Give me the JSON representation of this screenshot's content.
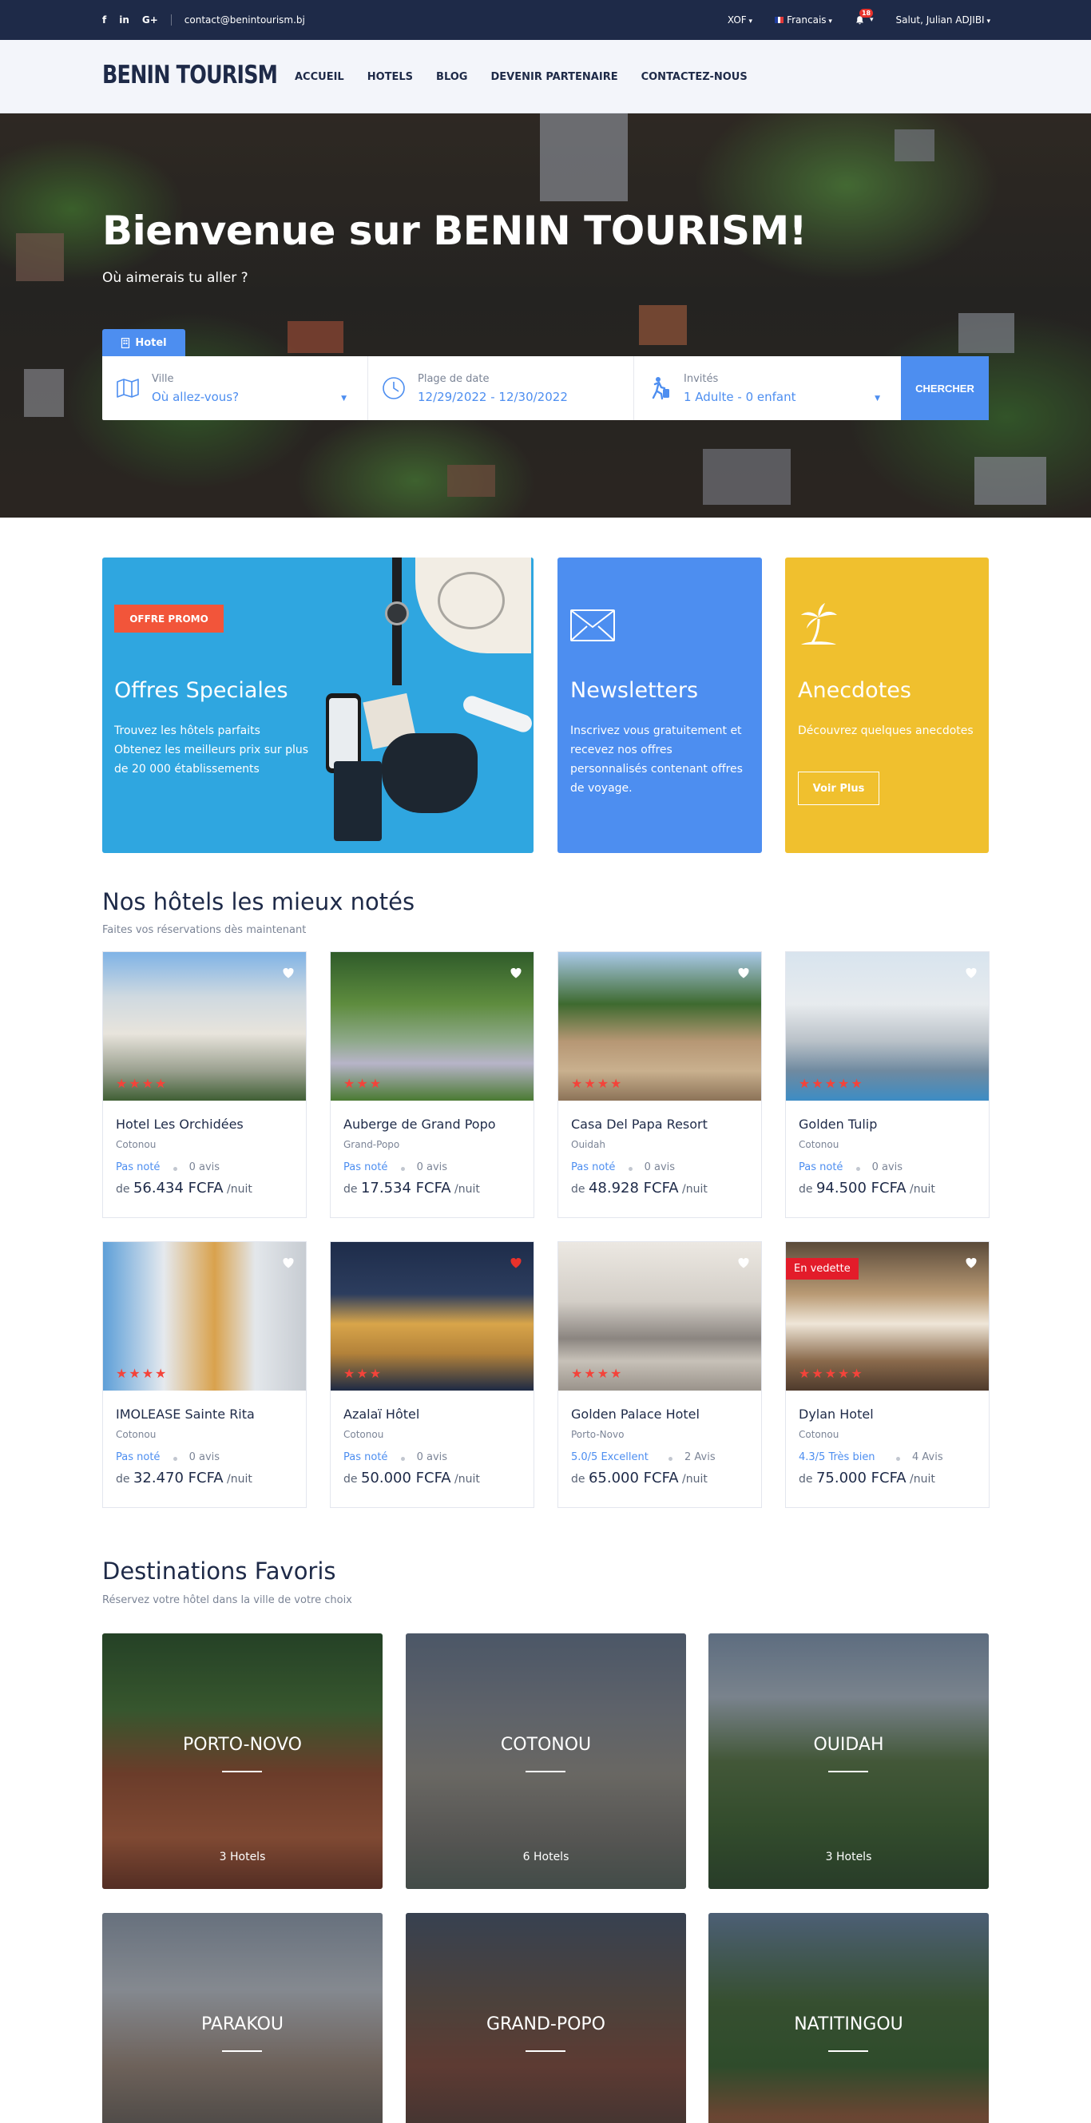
{
  "topbar": {
    "social": [
      "f",
      "in",
      "G+"
    ],
    "email": "contact@benintourism.bj",
    "currency": "XOF",
    "language": "Francais",
    "notification_count": "18",
    "user_greeting": "Salut, Julian ADJIBI"
  },
  "nav": {
    "logo": "BENIN TOURISM",
    "items": [
      "ACCUEIL",
      "HOTELS",
      "BLOG",
      "DEVENIR PARTENAIRE",
      "CONTACTEZ-NOUS"
    ]
  },
  "hero": {
    "title": "Bienvenue sur BENIN TOURISM!",
    "subtitle": "Où aimerais tu aller ?",
    "tab_label": "Hotel",
    "search": {
      "city_label": "Ville",
      "city_value": "Où  allez-vous?",
      "date_label": "Plage de date",
      "date_value": "12/29/2022 - 12/30/2022",
      "guests_label": "Invités",
      "guests_value": "1 Adulte - 0 enfant",
      "button": "CHERCHER"
    }
  },
  "promos": {
    "offers": {
      "badge": "OFFRE PROMO",
      "title": "Offres Speciales",
      "line1": "Trouvez les hôtels parfaits",
      "line2": "Obtenez les meilleurs prix sur plus",
      "line3": "de 20 000 établissements",
      "color": "#2fa6e0"
    },
    "newsletter": {
      "title": "Newsletters",
      "line1": "Inscrivez vous gratuitement et",
      "line2": "recevez nos offres",
      "line3": "personnalisés contenant offres",
      "line4": "de voyage.",
      "color": "#4d8ef0"
    },
    "anecdotes": {
      "title": "Anecdotes",
      "text": "Découvrez quelques anecdotes",
      "button": "Voir Plus",
      "color": "#f0c02e"
    }
  },
  "hotels_section": {
    "title": "Nos hôtels les mieux notés",
    "subtitle": "Faites vos réservations dès maintenant",
    "price_prefix": "de",
    "price_suffix": "/nuit",
    "hotels": [
      {
        "name": "Hotel Les Orchidées",
        "city": "Cotonou",
        "rating": "Pas noté",
        "reviews": "0 avis",
        "price": "56.434 FCFA",
        "stars": 4,
        "liked": false,
        "featured": ""
      },
      {
        "name": "Auberge de Grand Popo",
        "city": "Grand-Popo",
        "rating": "Pas noté",
        "reviews": "0 avis",
        "price": "17.534 FCFA",
        "stars": 3,
        "liked": false,
        "featured": ""
      },
      {
        "name": "Casa Del Papa Resort",
        "city": "Ouidah",
        "rating": "Pas noté",
        "reviews": "0 avis",
        "price": "48.928 FCFA",
        "stars": 4,
        "liked": false,
        "featured": ""
      },
      {
        "name": "Golden Tulip",
        "city": "Cotonou",
        "rating": "Pas noté",
        "reviews": "0 avis",
        "price": "94.500 FCFA",
        "stars": 5,
        "liked": false,
        "featured": ""
      },
      {
        "name": "IMOLEASE Sainte Rita",
        "city": "Cotonou",
        "rating": "Pas noté",
        "reviews": "0 avis",
        "price": "32.470 FCFA",
        "stars": 4,
        "liked": false,
        "featured": ""
      },
      {
        "name": "Azalaï Hôtel",
        "city": "Cotonou",
        "rating": "Pas noté",
        "reviews": "0 avis",
        "price": "50.000 FCFA",
        "stars": 3,
        "liked": true,
        "featured": ""
      },
      {
        "name": "Golden Palace Hotel",
        "city": "Porto-Novo",
        "rating": "5.0/5 Excellent",
        "reviews": "2 Avis",
        "price": "65.000 FCFA",
        "stars": 4,
        "liked": false,
        "featured": ""
      },
      {
        "name": "Dylan Hotel",
        "city": "Cotonou",
        "rating": "4.3/5 Très bien",
        "reviews": "4 Avis",
        "price": "75.000 FCFA",
        "stars": 5,
        "liked": false,
        "featured": "En vedette"
      }
    ]
  },
  "destinations_section": {
    "title": "Destinations Favoris",
    "subtitle": "Réservez votre hôtel dans la ville de votre choix",
    "items": [
      {
        "name": "PORTO-NOVO",
        "count": "3 Hotels"
      },
      {
        "name": "COTONOU",
        "count": "6 Hotels"
      },
      {
        "name": "OUIDAH",
        "count": "3 Hotels"
      },
      {
        "name": "PARAKOU",
        "count": ""
      },
      {
        "name": "GRAND-POPO",
        "count": ""
      },
      {
        "name": "NATITINGOU",
        "count": ""
      }
    ]
  }
}
